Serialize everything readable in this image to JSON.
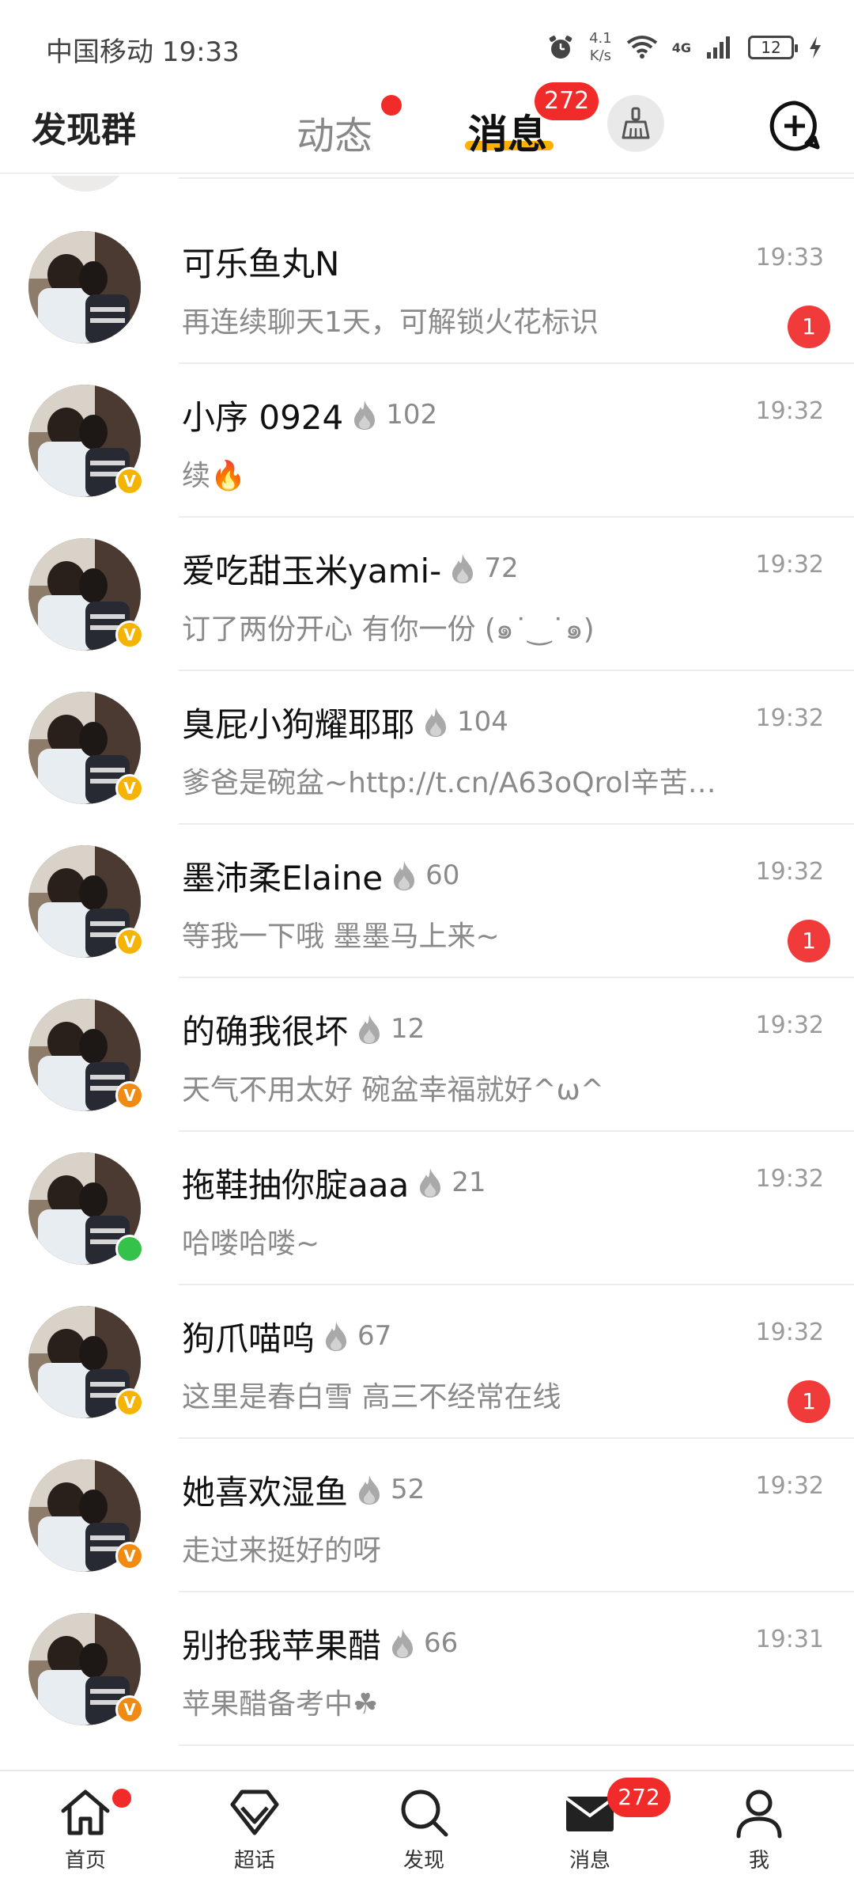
{
  "status_bar": {
    "carrier_time": "中国移动 19:33",
    "net_speed_value": "4.1",
    "net_speed_unit": "K/s",
    "network": "4G",
    "battery": "12"
  },
  "header": {
    "left_title": "发现群",
    "tab_dynamic": "动态",
    "tab_messages": "消息",
    "messages_badge": "272"
  },
  "conversations": [
    {
      "name": "可乐鱼丸N",
      "fire_count": "",
      "time": "19:33",
      "preview": "再连续聊天1天，可解锁火花标识",
      "unread": "1",
      "badge_type": "none"
    },
    {
      "name": "小序 0924",
      "fire_count": "102",
      "time": "19:32",
      "preview": "续🔥",
      "unread": "",
      "badge_type": "v-yellow"
    },
    {
      "name": "爱吃甜玉米yami-",
      "fire_count": "72",
      "time": "19:32",
      "preview": "订了两份开心  有你一份 (๑˙‿˙๑)",
      "unread": "",
      "badge_type": "v-yellow"
    },
    {
      "name": "臭屁小狗耀耶耶",
      "fire_count": "104",
      "time": "19:32",
      "preview": "爹爸是碗盆~http://t.cn/A63oQrol辛苦…",
      "unread": "",
      "badge_type": "v-yellow"
    },
    {
      "name": "墨沛柔Elaine",
      "fire_count": "60",
      "time": "19:32",
      "preview": "等我一下哦 墨墨马上来~",
      "unread": "1",
      "badge_type": "v-yellow"
    },
    {
      "name": "的确我很坏",
      "fire_count": "12",
      "time": "19:32",
      "preview": "天气不用太好 碗盆幸福就好^ω^",
      "unread": "",
      "badge_type": "v-orange"
    },
    {
      "name": "拖鞋抽你腚aaa",
      "fire_count": "21",
      "time": "19:32",
      "preview": "哈喽哈喽~",
      "unread": "",
      "badge_type": "online"
    },
    {
      "name": "狗爪喵呜",
      "fire_count": "67",
      "time": "19:32",
      "preview": "这里是春白雪 高三不经常在线",
      "unread": "1",
      "badge_type": "v-yellow"
    },
    {
      "name": "她喜欢湿鱼",
      "fire_count": "52",
      "time": "19:32",
      "preview": "走过来挺好的呀",
      "unread": "",
      "badge_type": "v-orange"
    },
    {
      "name": "别抢我苹果醋",
      "fire_count": "66",
      "time": "19:31",
      "preview": "苹果醋备考中☘",
      "unread": "",
      "badge_type": "v-orange"
    }
  ],
  "bottom_nav": {
    "home": "首页",
    "super_topic": "超话",
    "discover": "发现",
    "messages": "消息",
    "messages_badge": "272",
    "me": "我"
  },
  "colors": {
    "accent_red": "#f12a2a",
    "tab_underline": "#ffb000",
    "v_yellow": "#f5b400",
    "v_orange": "#f08a12",
    "online_green": "#35c24a"
  }
}
